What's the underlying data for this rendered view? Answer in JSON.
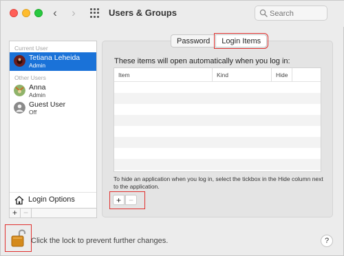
{
  "window": {
    "title": "Users & Groups"
  },
  "toolbar": {
    "back_icon": "chevron-left-icon",
    "forward_icon": "chevron-right-icon",
    "grid_icon": "grid-icon"
  },
  "search": {
    "placeholder": "Search"
  },
  "sidebar": {
    "current_user_label": "Current User",
    "other_users_label": "Other Users",
    "users": [
      {
        "name": "Tetiana Leheida",
        "role": "Admin",
        "selected": true
      },
      {
        "name": "Anna",
        "role": "Admin",
        "selected": false
      },
      {
        "name": "Guest User",
        "role": "Off",
        "selected": false
      }
    ],
    "login_options_label": "Login Options",
    "add_label": "+",
    "remove_label": "−"
  },
  "tabs": [
    {
      "label": "Password",
      "active": false
    },
    {
      "label": "Login Items",
      "active": true
    }
  ],
  "login_items": {
    "heading": "These items will open automatically when you log in:",
    "columns": [
      "Item",
      "Kind",
      "Hide"
    ],
    "rows": [],
    "hint": "To hide an application when you log in, select the tickbox in the Hide column next to the application.",
    "add_label": "+",
    "remove_label": "−"
  },
  "footer": {
    "lock_text": "Click the lock to prevent further changes.",
    "help_label": "?"
  },
  "colors": {
    "selection": "#1a72d8",
    "highlight": "#e0302e"
  }
}
